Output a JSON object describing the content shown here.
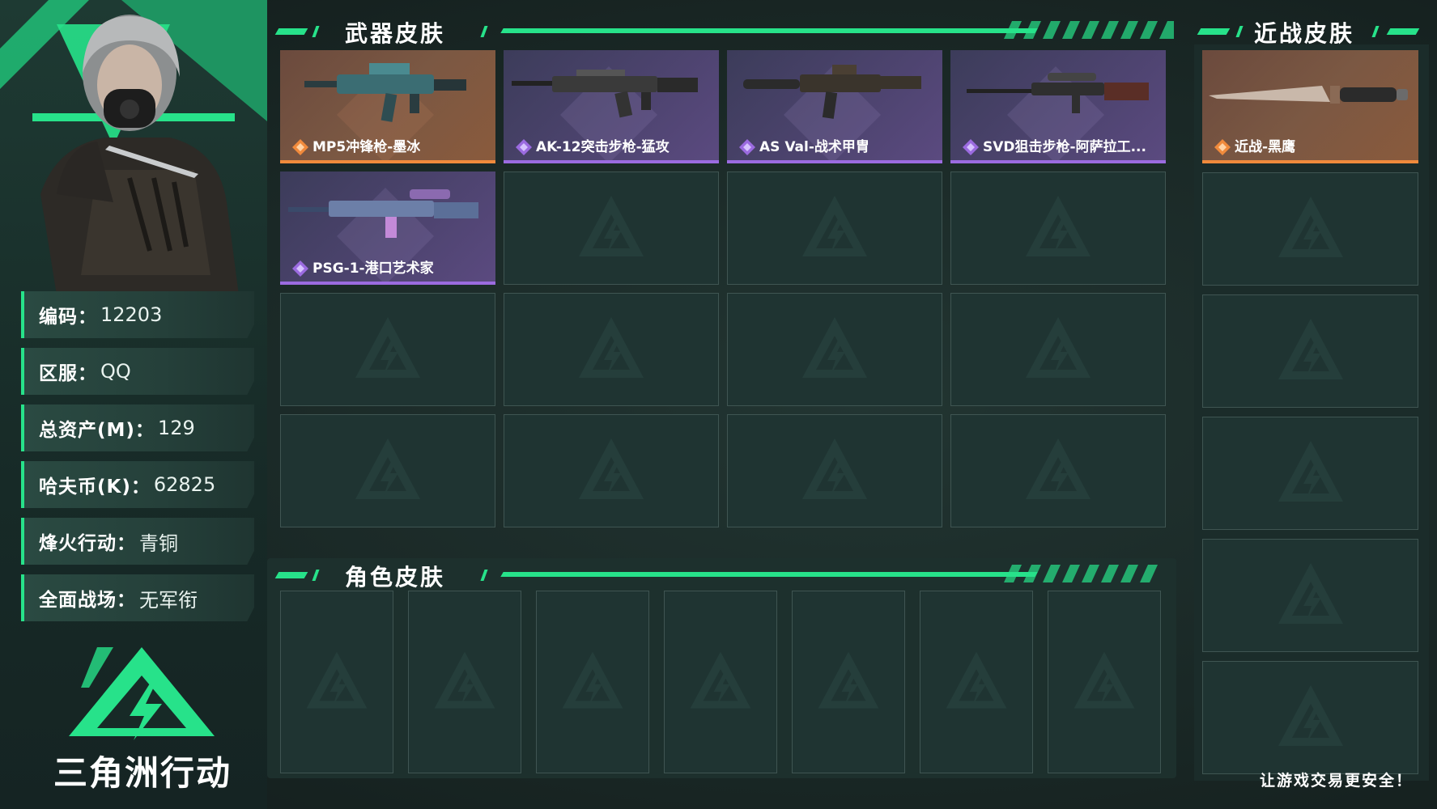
{
  "profile": {
    "info": [
      {
        "key": "编码：",
        "value": "12203"
      },
      {
        "key": "区服：",
        "value": "QQ"
      },
      {
        "key": "总资产(M)：",
        "value": "129"
      },
      {
        "key": "哈夫币(K)：",
        "value": "62825"
      },
      {
        "key": "烽火行动：",
        "value": "青铜"
      },
      {
        "key": "全面战场：",
        "value": "无军衔"
      }
    ],
    "game_logo_text": "三角洲行动"
  },
  "sections": {
    "weapon_title": "武器皮肤",
    "melee_title": "近战皮肤",
    "character_title": "角色皮肤"
  },
  "weapon_skins": [
    {
      "name": "MP5冲锋枪-墨冰",
      "rarity": "orange",
      "icon": "smg-icon"
    },
    {
      "name": "AK-12突击步枪-猛攻",
      "rarity": "purple",
      "icon": "rifle-icon"
    },
    {
      "name": "AS Val-战术甲胄",
      "rarity": "purple",
      "icon": "rifle-icon"
    },
    {
      "name": "SVD狙击步枪-阿萨拉工...",
      "rarity": "purple",
      "icon": "sniper-icon"
    },
    {
      "name": "PSG-1-港口艺术家",
      "rarity": "purple",
      "icon": "sniper-icon"
    }
  ],
  "melee_skins": [
    {
      "name": "近战-黑鹰",
      "rarity": "orange",
      "icon": "knife-icon"
    }
  ],
  "footer": {
    "slogan": "让游戏交易更安全！"
  },
  "colors": {
    "accent": "#27e28a",
    "orange": "#f08a3c",
    "purple": "#9b6be0",
    "empty_cell": "#1f3432"
  }
}
